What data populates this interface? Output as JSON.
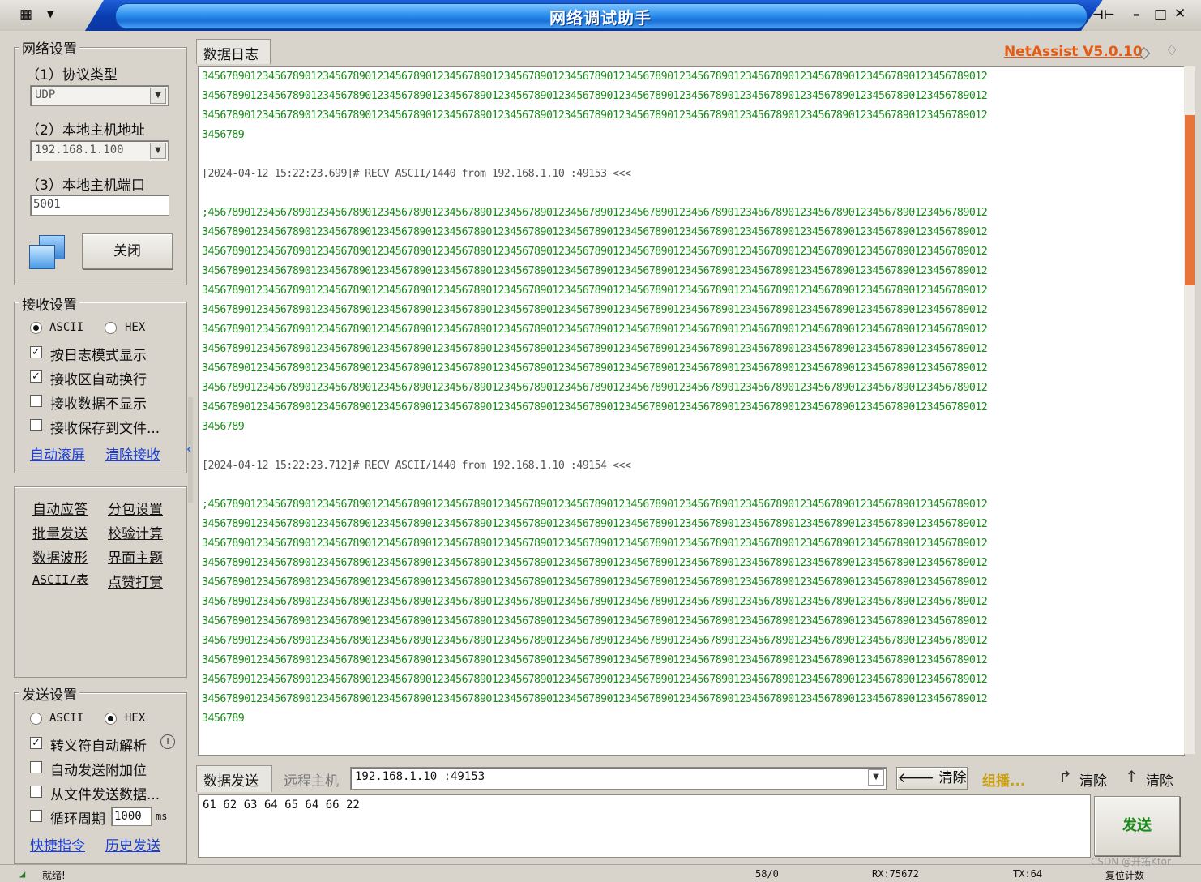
{
  "window": {
    "title": "网络调试助手",
    "version": "NetAssist V5.0.10"
  },
  "network": {
    "group_title": "网络设置",
    "protocol_label": "（1）协议类型",
    "protocol_value": "UDP",
    "host_label": "（2）本地主机地址",
    "host_value": "192.168.1.100",
    "port_label": "（3）本地主机端口",
    "port_value": "5001",
    "close_button": "关闭"
  },
  "receive": {
    "group_title": "接收设置",
    "ascii": "ASCII",
    "hex": "HEX",
    "mode_selected": "ASCII",
    "log_mode": "按日志模式显示",
    "auto_wrap": "接收区自动换行",
    "hide_data": "接收数据不显示",
    "save_file": "接收保存到文件...",
    "auto_scroll": "自动滚屏",
    "clear_recv": "清除接收"
  },
  "tools": {
    "items": [
      "自动应答",
      "分包设置",
      "批量发送",
      "校验计算",
      "数据波形",
      "界面主题",
      "ASCII/表",
      "点赞打赏"
    ]
  },
  "send": {
    "group_title": "发送设置",
    "ascii": "ASCII",
    "hex": "HEX",
    "mode_selected": "HEX",
    "escape_parse": "转义符自动解析",
    "append_check": "自动发送附加位",
    "from_file": "从文件发送数据...",
    "cycle": "循环周期",
    "cycle_value": "1000",
    "cycle_unit": "ms",
    "shortcut": "快捷指令",
    "history": "历史发送"
  },
  "log_tab": "数据日志",
  "log_lines": [
    {
      "type": "data",
      "text": "3456789012345678901234567890123456789012345678901234567890123456789012345678901234567890123456789012345678901234567890123456789012"
    },
    {
      "type": "data",
      "text": "3456789012345678901234567890123456789012345678901234567890123456789012345678901234567890123456789012345678901234567890123456789012"
    },
    {
      "type": "data",
      "text": "3456789012345678901234567890123456789012345678901234567890123456789012345678901234567890123456789012345678901234567890123456789012"
    },
    {
      "type": "data",
      "text": "3456789"
    },
    {
      "type": "blank",
      "text": ""
    },
    {
      "type": "hdr",
      "text": "[2024-04-12 15:22:23.699]# RECV ASCII/1440 from 192.168.1.10 :49153 <<<"
    },
    {
      "type": "blank",
      "text": ""
    },
    {
      "type": "data",
      "text": ";456789012345678901234567890123456789012345678901234567890123456789012345678901234567890123456789012345678901234567890123456789012"
    },
    {
      "type": "data",
      "text": "3456789012345678901234567890123456789012345678901234567890123456789012345678901234567890123456789012345678901234567890123456789012"
    },
    {
      "type": "data",
      "text": "3456789012345678901234567890123456789012345678901234567890123456789012345678901234567890123456789012345678901234567890123456789012"
    },
    {
      "type": "data",
      "text": "3456789012345678901234567890123456789012345678901234567890123456789012345678901234567890123456789012345678901234567890123456789012"
    },
    {
      "type": "data",
      "text": "3456789012345678901234567890123456789012345678901234567890123456789012345678901234567890123456789012345678901234567890123456789012"
    },
    {
      "type": "data",
      "text": "3456789012345678901234567890123456789012345678901234567890123456789012345678901234567890123456789012345678901234567890123456789012"
    },
    {
      "type": "data",
      "text": "3456789012345678901234567890123456789012345678901234567890123456789012345678901234567890123456789012345678901234567890123456789012"
    },
    {
      "type": "data",
      "text": "3456789012345678901234567890123456789012345678901234567890123456789012345678901234567890123456789012345678901234567890123456789012"
    },
    {
      "type": "data",
      "text": "3456789012345678901234567890123456789012345678901234567890123456789012345678901234567890123456789012345678901234567890123456789012"
    },
    {
      "type": "data",
      "text": "3456789012345678901234567890123456789012345678901234567890123456789012345678901234567890123456789012345678901234567890123456789012"
    },
    {
      "type": "data",
      "text": "3456789012345678901234567890123456789012345678901234567890123456789012345678901234567890123456789012345678901234567890123456789012"
    },
    {
      "type": "data",
      "text": "3456789"
    },
    {
      "type": "blank",
      "text": ""
    },
    {
      "type": "hdr",
      "text": "[2024-04-12 15:22:23.712]# RECV ASCII/1440 from 192.168.1.10 :49154 <<<"
    },
    {
      "type": "blank",
      "text": ""
    },
    {
      "type": "data",
      "text": ";456789012345678901234567890123456789012345678901234567890123456789012345678901234567890123456789012345678901234567890123456789012"
    },
    {
      "type": "data",
      "text": "3456789012345678901234567890123456789012345678901234567890123456789012345678901234567890123456789012345678901234567890123456789012"
    },
    {
      "type": "data",
      "text": "3456789012345678901234567890123456789012345678901234567890123456789012345678901234567890123456789012345678901234567890123456789012"
    },
    {
      "type": "data",
      "text": "3456789012345678901234567890123456789012345678901234567890123456789012345678901234567890123456789012345678901234567890123456789012"
    },
    {
      "type": "data",
      "text": "3456789012345678901234567890123456789012345678901234567890123456789012345678901234567890123456789012345678901234567890123456789012"
    },
    {
      "type": "data",
      "text": "3456789012345678901234567890123456789012345678901234567890123456789012345678901234567890123456789012345678901234567890123456789012"
    },
    {
      "type": "data",
      "text": "3456789012345678901234567890123456789012345678901234567890123456789012345678901234567890123456789012345678901234567890123456789012"
    },
    {
      "type": "data",
      "text": "3456789012345678901234567890123456789012345678901234567890123456789012345678901234567890123456789012345678901234567890123456789012"
    },
    {
      "type": "data",
      "text": "3456789012345678901234567890123456789012345678901234567890123456789012345678901234567890123456789012345678901234567890123456789012"
    },
    {
      "type": "data",
      "text": "3456789012345678901234567890123456789012345678901234567890123456789012345678901234567890123456789012345678901234567890123456789012"
    },
    {
      "type": "data",
      "text": "3456789012345678901234567890123456789012345678901234567890123456789012345678901234567890123456789012345678901234567890123456789012"
    },
    {
      "type": "data",
      "text": "3456789"
    }
  ],
  "send_bar": {
    "tab": "数据发送",
    "remote_label": "远程主机",
    "remote_value": "192.168.1.10 :49153",
    "clear1": "清除",
    "multicast": "组播...",
    "clear2": "清除",
    "clear3": "清除",
    "send_button": "发送",
    "send_text": "61 62 63 64 65 64 66 22"
  },
  "status": {
    "ready": "就绪!",
    "count": "58/0",
    "rx": "RX:75672",
    "tx": "TX:64",
    "reset": "复位计数",
    "watermark": "CSDN @开拓Ktor"
  },
  "colors": {
    "log_data": "#1a8a1a",
    "log_header": "#555555",
    "version": "#e85a10",
    "link": "#1a3fd8",
    "title_bar": "#1a70d8"
  }
}
